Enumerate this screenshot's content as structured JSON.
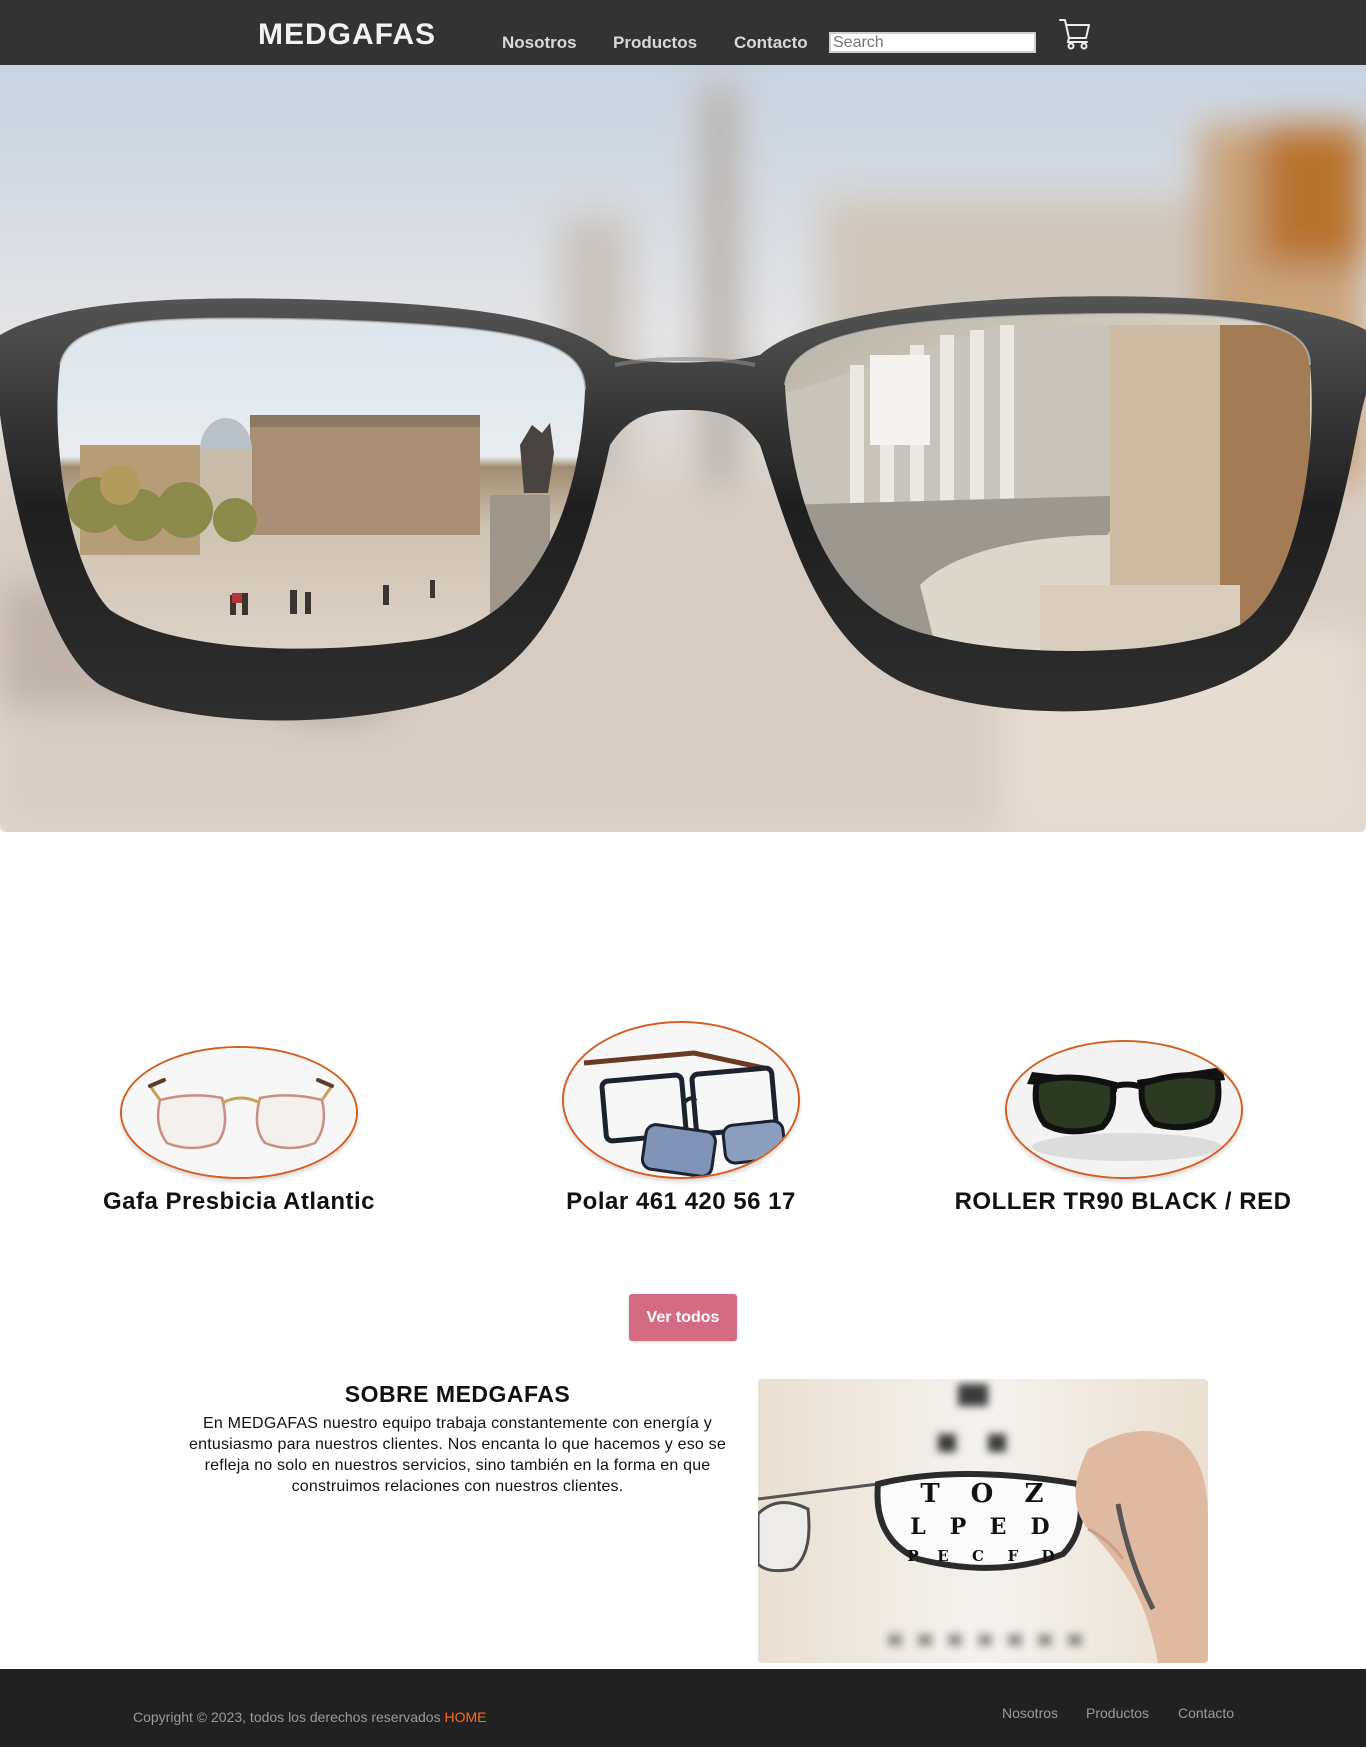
{
  "nav": {
    "brand": "MEDGAFAS",
    "links": [
      "Nosotros",
      "Productos",
      "Contacto"
    ],
    "search_placeholder": "Search",
    "cart_icon": "cart-icon"
  },
  "products": [
    {
      "name": "Gafa Presbicia Atlantic"
    },
    {
      "name": "Polar 461 420 56 17"
    },
    {
      "name": "ROLLER TR90 BLACK / RED"
    }
  ],
  "ver_todos": "Ver todos",
  "about": {
    "title": "SOBRE MEDGAFAS",
    "text": "En MEDGAFAS nuestro equipo trabaja constantemente con energía y entusiasmo para nuestros clientes. Nos encanta lo que hacemos y eso se refleja no solo en nuestros servicios, sino también en la forma en que construimos relaciones con nuestros clientes.",
    "chart_letters": [
      "T",
      "O",
      "Z",
      "L",
      "P",
      "E",
      "D",
      "P",
      "E",
      "C",
      "F",
      "D"
    ]
  },
  "footer": {
    "copyright": "Copyright © 2023, todos los derechos reservados ",
    "home": "HOME",
    "links": [
      "Nosotros",
      "Productos",
      "Contacto"
    ]
  },
  "colors": {
    "nav_bg": "#333333",
    "accent_orange": "#d45e1e",
    "button_pink": "#d56b82",
    "footer_bg": "#212121",
    "home_link": "#ff6a1a"
  }
}
